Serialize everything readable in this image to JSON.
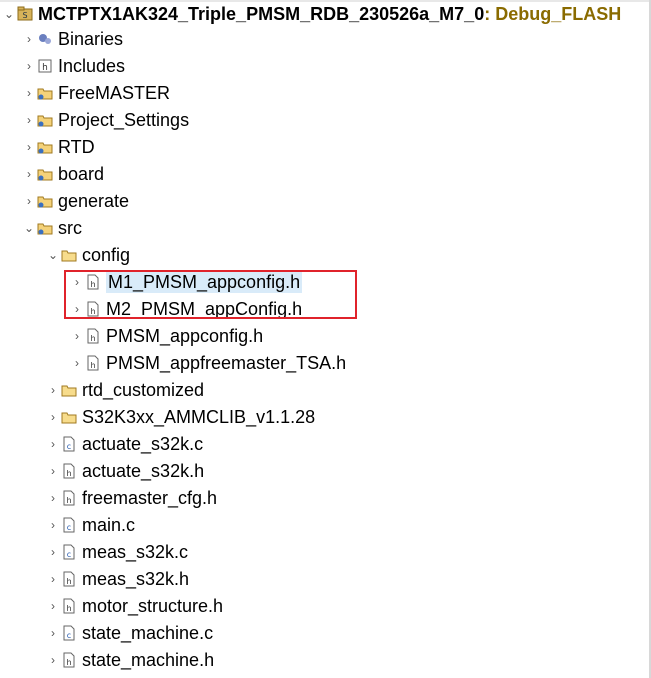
{
  "project": {
    "name": "MCTPTX1AK324_Triple_PMSM_RDB_230526a_M7_0",
    "decoration": ": Debug_FLASH"
  },
  "tree": [
    {
      "label": "Binaries",
      "icon": "binaries-icon",
      "chevron": "right"
    },
    {
      "label": "Includes",
      "icon": "includes-icon",
      "chevron": "right"
    },
    {
      "label": "FreeMASTER",
      "icon": "source-folder-icon",
      "chevron": "right"
    },
    {
      "label": "Project_Settings",
      "icon": "source-folder-icon",
      "chevron": "right"
    },
    {
      "label": "RTD",
      "icon": "source-folder-icon",
      "chevron": "right"
    },
    {
      "label": "board",
      "icon": "source-folder-icon",
      "chevron": "right"
    },
    {
      "label": "generate",
      "icon": "source-folder-icon",
      "chevron": "right"
    },
    {
      "label": "src",
      "icon": "source-folder-icon",
      "chevron": "down"
    },
    {
      "label": "config",
      "icon": "folder-icon",
      "chevron": "down"
    },
    {
      "label": "M1_PMSM_appconfig.h",
      "icon": "header-file-icon",
      "chevron": "right"
    },
    {
      "label": "M2_PMSM_appConfig.h",
      "icon": "header-file-icon",
      "chevron": "right"
    },
    {
      "label": "PMSM_appconfig.h",
      "icon": "header-file-icon",
      "chevron": "right"
    },
    {
      "label": "PMSM_appfreemaster_TSA.h",
      "icon": "header-file-icon",
      "chevron": "right"
    },
    {
      "label": "rtd_customized",
      "icon": "folder-icon",
      "chevron": "right"
    },
    {
      "label": "S32K3xx_AMMCLIB_v1.1.28",
      "icon": "folder-icon",
      "chevron": "right"
    },
    {
      "label": "actuate_s32k.c",
      "icon": "c-file-icon",
      "chevron": "right"
    },
    {
      "label": "actuate_s32k.h",
      "icon": "header-file-icon",
      "chevron": "right"
    },
    {
      "label": "freemaster_cfg.h",
      "icon": "header-file-icon",
      "chevron": "right"
    },
    {
      "label": "main.c",
      "icon": "c-file-icon",
      "chevron": "right"
    },
    {
      "label": "meas_s32k.c",
      "icon": "c-file-icon",
      "chevron": "right"
    },
    {
      "label": "meas_s32k.h",
      "icon": "header-file-icon",
      "chevron": "right"
    },
    {
      "label": "motor_structure.h",
      "icon": "header-file-icon",
      "chevron": "right"
    },
    {
      "label": "state_machine.c",
      "icon": "c-file-icon",
      "chevron": "right"
    },
    {
      "label": "state_machine.h",
      "icon": "header-file-icon",
      "chevron": "right"
    }
  ],
  "colors": {
    "highlight_box": "#e0232b",
    "selection": "#d9ebf9",
    "decoration": "#8a6b00"
  }
}
